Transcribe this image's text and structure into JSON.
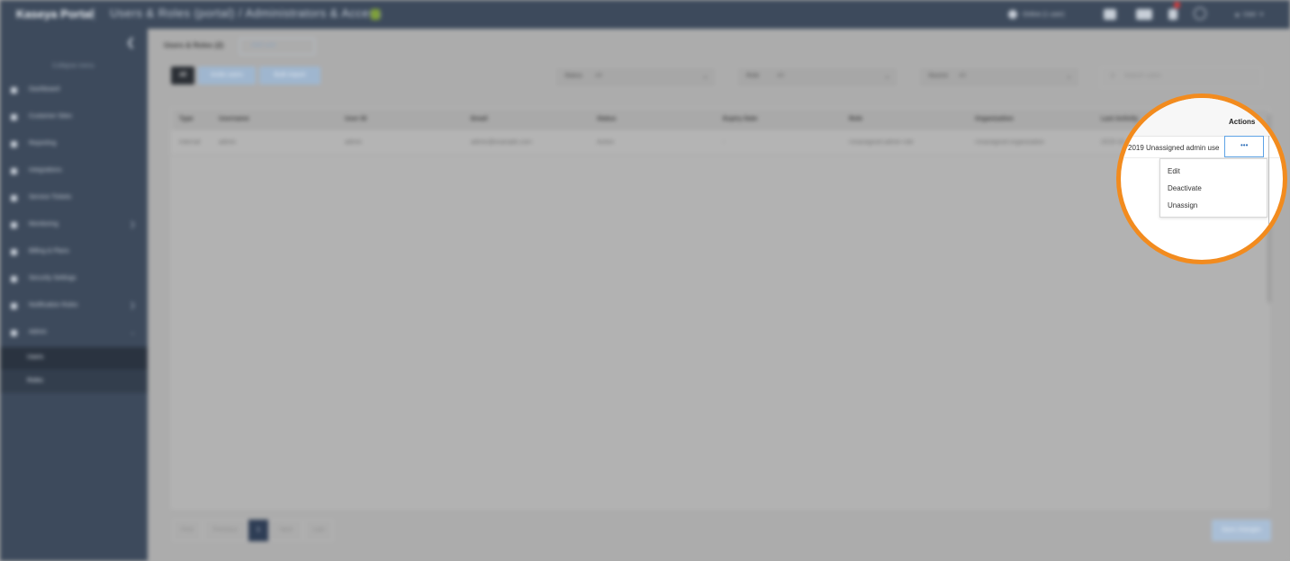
{
  "app": {
    "brand": "Kaseya Portal",
    "breadcrumb": "Users & Roles (portal) / Administrators & Access"
  },
  "topbar": {
    "user_chip": "Online (1 user)",
    "user_menu": "User"
  },
  "sidebar": {
    "hint": "Collapse menu",
    "items": [
      {
        "label": "Dashboard",
        "icon": "home-icon"
      },
      {
        "label": "Customer Sites",
        "icon": "users-icon"
      },
      {
        "label": "Reporting",
        "icon": "chart-icon"
      },
      {
        "label": "Integrations",
        "icon": "link-icon"
      },
      {
        "label": "Service Tickets",
        "icon": "ticket-icon"
      },
      {
        "label": "Monitoring",
        "icon": "monitor-icon"
      },
      {
        "label": "Billing & Plans",
        "icon": "card-icon"
      },
      {
        "label": "Security Settings",
        "icon": "shield-icon"
      },
      {
        "label": "Notification Rules",
        "icon": "bell-icon"
      },
      {
        "label": "Admin",
        "icon": "gear-icon"
      }
    ],
    "sub_items": [
      {
        "label": "Users"
      },
      {
        "label": "Roles"
      }
    ]
  },
  "page": {
    "title": "Users & Roles (2)",
    "title_tab": "Add user"
  },
  "toolbar": {
    "primary_label": "All",
    "btn_a": "Invite users",
    "btn_b": "Bulk import"
  },
  "filters": [
    {
      "label": "Status",
      "value": "All"
    },
    {
      "label": "Role",
      "value": "All"
    },
    {
      "label": "Source",
      "value": "All"
    }
  ],
  "search": {
    "placeholder": "Search users"
  },
  "table": {
    "columns": [
      "Type",
      "Username",
      "User ID",
      "Email",
      "Status",
      "Expiry Date",
      "Role",
      "Organization",
      "Last Activity"
    ],
    "rows": [
      [
        "Internal",
        "admin",
        "admin",
        "admin@example.com",
        "Active",
        "-",
        "Unassigned admin role",
        "Unassigned organization",
        "2019 Un"
      ]
    ]
  },
  "pagination": {
    "items": [
      "First",
      "Previous",
      "1",
      "Next",
      "Last"
    ],
    "active": "1"
  },
  "footer": {
    "save_label": "Save changes"
  },
  "magnifier": {
    "actions_header": "Actions",
    "cell_text": "2019 Unassigned admin use",
    "actions_button": "•••",
    "menu": [
      "Edit",
      "Deactivate",
      "Unassign"
    ],
    "ring_color": "#f28b1e"
  },
  "colors": {
    "sidebar": "#3d4a5c",
    "accent": "#5ea3e6",
    "highlight": "#f28b1e"
  }
}
